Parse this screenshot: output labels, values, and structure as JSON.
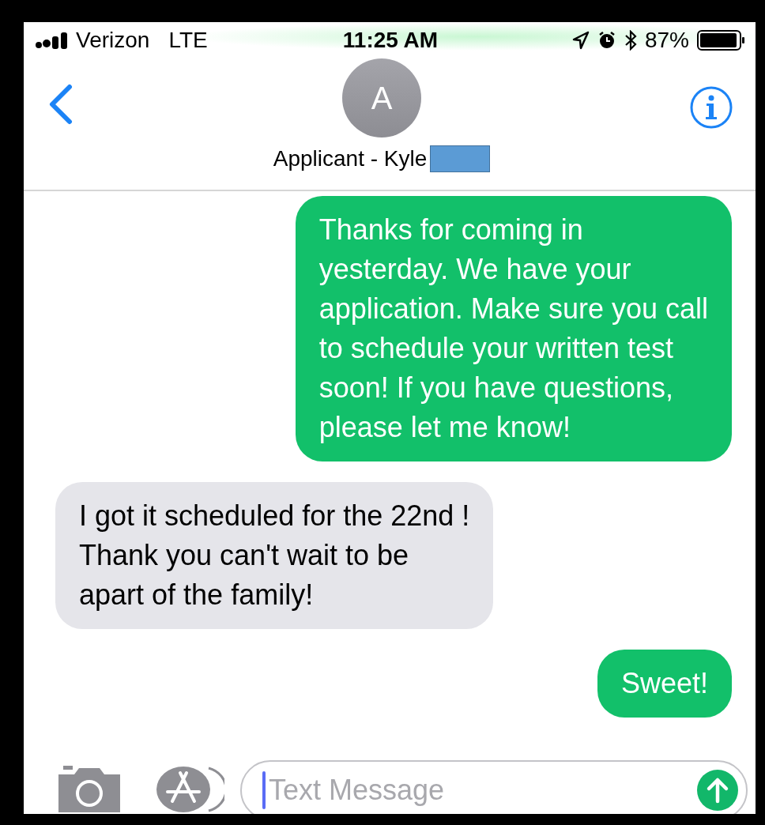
{
  "status_bar": {
    "carrier": "Verizon",
    "network": "LTE",
    "time": "11:25 AM",
    "battery": "87%"
  },
  "header": {
    "avatar_initial": "A",
    "contact_name": "Applicant - Kyle"
  },
  "messages": [
    {
      "kind": "sent",
      "text": "Thanks for coming in\nyesterday.  We have your\napplication. Make sure you call\nto schedule your written test\nsoon! If you have questions,\nplease let me know!"
    },
    {
      "kind": "received",
      "text": "I got it scheduled for the 22nd !\nThank you can't wait to be\napart of the family!"
    },
    {
      "kind": "sent",
      "text": "Sweet!"
    }
  ],
  "composer": {
    "placeholder": "Text Message"
  }
}
